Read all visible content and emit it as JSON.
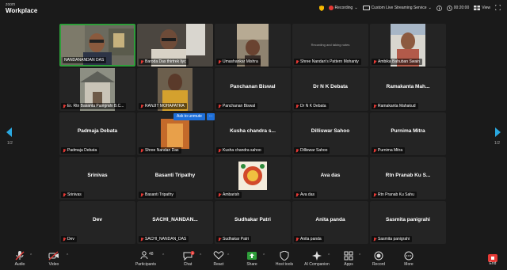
{
  "app": {
    "brand_small": "zoom",
    "brand_big": "Workplace"
  },
  "topbar": {
    "recording_label": "Recording",
    "stream_label": "Custom Live Streaming Service",
    "timer": "00:20:00",
    "view_label": "View"
  },
  "navigation": {
    "page_left": "1/2",
    "page_right": "1/2"
  },
  "participants": [
    {
      "label": "NANDANANDAN DAS",
      "center": "",
      "muted": false
    },
    {
      "label": "Baroda Das thirtrek liyc",
      "center": "",
      "muted": true
    },
    {
      "label": "Umashankar Mishra",
      "center": "",
      "muted": true
    },
    {
      "label": "Shree Nandan's Pattern Mohanty",
      "center": "",
      "muted": true
    },
    {
      "label": "Ambika Bahuban Swain",
      "center": "",
      "muted": true
    },
    {
      "label": "Er. Rtn Basanta Panigrahi B.C...",
      "center": "",
      "muted": true
    },
    {
      "label": "RANJIT MOHAPATRA",
      "center": "",
      "muted": true
    },
    {
      "label": "Panchanan Biswal",
      "center": "Panchanan Biswal",
      "muted": true
    },
    {
      "label": "Dr N K Debata",
      "center": "Dr N K Debata",
      "muted": true
    },
    {
      "label": "Ramakanta Mahakud",
      "center": "Ramakanta Mah...",
      "muted": true
    },
    {
      "label": "Padmaja Debata",
      "center": "Padmaja Debata",
      "muted": true
    },
    {
      "label": "Shree Nandan Das",
      "center": "",
      "muted": true
    },
    {
      "label": "Kusha chandra sahoo",
      "center": "Kusha chandra s...",
      "muted": true
    },
    {
      "label": "Dilliswar Sahoo",
      "center": "Dilliswar Sahoo",
      "muted": true
    },
    {
      "label": "Purnima Mitra",
      "center": "Purnima Mitra",
      "muted": true
    },
    {
      "label": "Srinivas",
      "center": "Srinivas",
      "muted": true
    },
    {
      "label": "Basanti Tripathy",
      "center": "Basanti Tripathy",
      "muted": true
    },
    {
      "label": "Ambarish",
      "center": "",
      "muted": true
    },
    {
      "label": "Ava das",
      "center": "Ava das",
      "muted": true
    },
    {
      "label": "Rtn Pranab Ku Sahu",
      "center": "Rtn Pranab Ku S...",
      "muted": true
    },
    {
      "label": "Dev",
      "center": "Dev",
      "muted": true
    },
    {
      "label": "SACHI_NANDAN_DAS",
      "center": "SACHI_NANDAN...",
      "muted": true
    },
    {
      "label": "Sudhakar Patri",
      "center": "Sudhakar Patri",
      "muted": true
    },
    {
      "label": "Anita panda",
      "center": "Anita panda",
      "muted": true
    },
    {
      "label": "Sasmita panigrahi",
      "center": "Sasmita panigrahi",
      "muted": true
    }
  ],
  "tile_extra": {
    "recording_notice": "Recording and taking notes"
  },
  "unmute": {
    "label": "Ask to unmute",
    "more": "..."
  },
  "toolbar": {
    "audio": "Audio",
    "video": "Video",
    "participants": "Participants",
    "participants_count": "48",
    "chat": "Chat",
    "chat_badge": "1",
    "react": "React",
    "share": "Share",
    "host_tools": "Host tools",
    "ai_companion": "AI Companion",
    "apps": "Apps",
    "record": "Record",
    "more": "More",
    "end": "End"
  },
  "colors": {
    "active_border": "#2e9e3a",
    "muted_red": "#e53935",
    "share_green": "#2e9e3a",
    "end_red": "#e53935",
    "accent_blue": "#1e6fd9",
    "nav_arrow": "#2aa8e0"
  }
}
